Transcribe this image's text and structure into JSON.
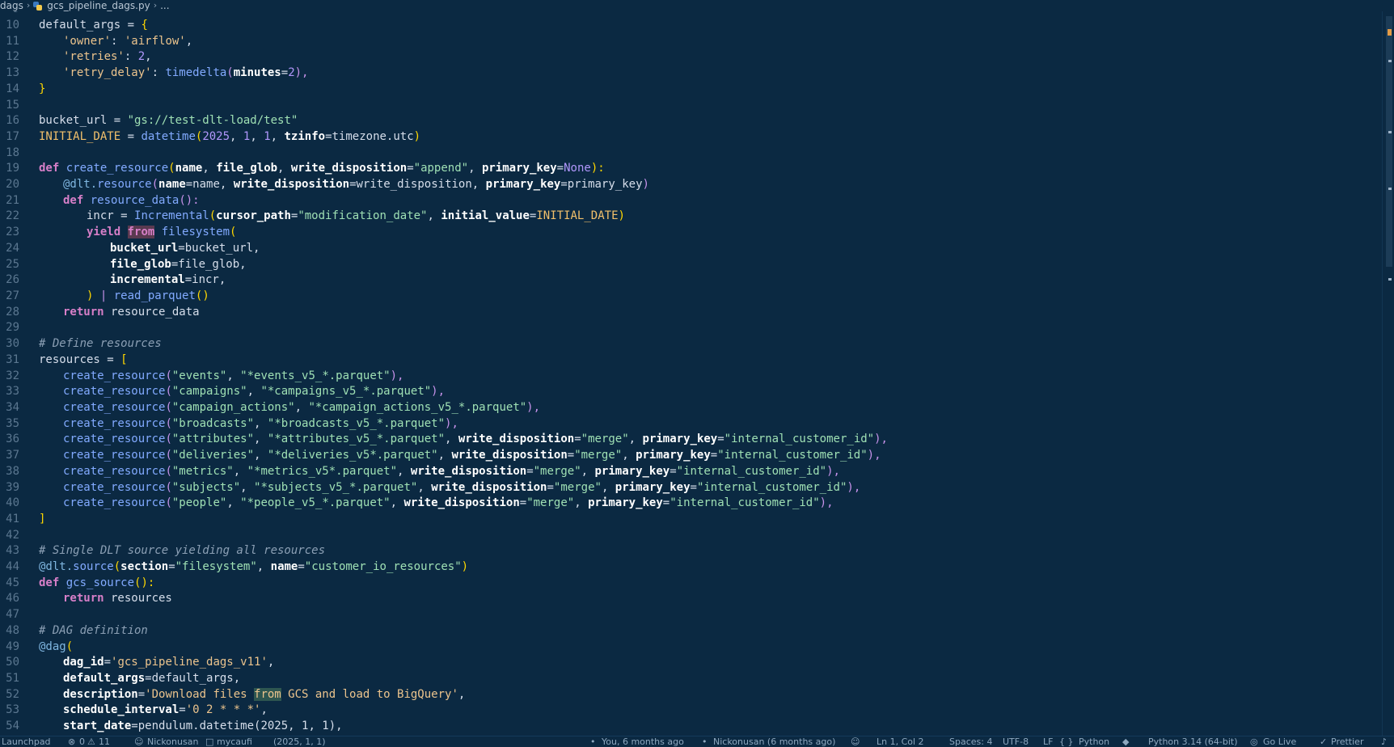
{
  "breadcrumb": {
    "folder": "dags",
    "file": "gcs_pipeline_dags.py",
    "more": "..."
  },
  "editor": {
    "first_visible_line": "9"
  },
  "code": {
    "l10": {
      "ln": "10",
      "t1": "default_args = ",
      "t2": "{"
    },
    "l11": {
      "ln": "11",
      "t1": "'owner'",
      "t2": ": ",
      "t3": "'airflow'",
      "t4": ","
    },
    "l12": {
      "ln": "12",
      "t1": "'retries'",
      "t2": ": ",
      "t3": "2",
      "t4": ","
    },
    "l13": {
      "ln": "13",
      "t1": "'retry_delay'",
      "t2": ": ",
      "t3": "timedelta",
      "t4": "(",
      "t5": "minutes",
      "t6": "=",
      "t7": "2",
      "t8": "),"
    },
    "l14": {
      "ln": "14",
      "t1": "}"
    },
    "l15": {
      "ln": "15"
    },
    "l16": {
      "ln": "16",
      "t1": "bucket_url = ",
      "t2": "\"gs://test-dlt-load/test\""
    },
    "l17": {
      "ln": "17",
      "t1": "INITIAL_DATE",
      "t2": " = ",
      "t3": "datetime",
      "t4": "(",
      "t5": "2025",
      "t6": ", ",
      "t7": "1",
      "t8": ", ",
      "t9": "1",
      "t10": ", ",
      "t11": "tzinfo",
      "t12": "=timezone.utc",
      "t13": ")"
    },
    "l18": {
      "ln": "18"
    },
    "l19": {
      "ln": "19",
      "t1": "def",
      "t2": " ",
      "t3": "create_resource",
      "t4": "(",
      "t5": "name",
      "t6": ", ",
      "t7": "file_glob",
      "t8": ", ",
      "t9": "write_disposition",
      "t10": "=",
      "t11": "\"append\"",
      "t12": ", ",
      "t13": "primary_key",
      "t14": "=",
      "t15": "None",
      "t16": "):"
    },
    "l20": {
      "ln": "20",
      "t1": "@dlt.",
      "t2": "resource",
      "t3": "(",
      "t4": "name",
      "t5": "=name, ",
      "t6": "write_disposition",
      "t7": "=write_disposition, ",
      "t8": "primary_key",
      "t9": "=primary_key",
      "t10": ")"
    },
    "l21": {
      "ln": "21",
      "t1": "def",
      "t2": " ",
      "t3": "resource_data",
      "t4": "():"
    },
    "l22": {
      "ln": "22",
      "t1": "incr = ",
      "t2": "Incremental",
      "t3": "(",
      "t4": "cursor_path",
      "t5": "=",
      "t6": "\"modification_date\"",
      "t7": ", ",
      "t8": "initial_value",
      "t9": "=",
      "t10": "INITIAL_DATE",
      "t11": ")"
    },
    "l23": {
      "ln": "23",
      "t1": "yield",
      "t2": " ",
      "t3": "from",
      "t4": " ",
      "t5": "filesystem",
      "t6": "("
    },
    "l24": {
      "ln": "24",
      "t1": "bucket_url",
      "t2": "=bucket_url,"
    },
    "l25": {
      "ln": "25",
      "t1": "file_glob",
      "t2": "=file_glob,"
    },
    "l26": {
      "ln": "26",
      "t1": "incremental",
      "t2": "=incr,"
    },
    "l27": {
      "ln": "27",
      "t1": ")",
      "t2": " | ",
      "t3": "read_parquet",
      "t4": "()"
    },
    "l28": {
      "ln": "28",
      "t1": "return",
      "t2": " resource_data"
    },
    "l29": {
      "ln": "29"
    },
    "l30": {
      "ln": "30",
      "t1": "# Define resources"
    },
    "l31": {
      "ln": "31",
      "t1": "resources = ",
      "t2": "["
    },
    "l32": {
      "ln": "32",
      "t1": "create_resource",
      "t2": "(",
      "t3": "\"events\"",
      "t4": ", ",
      "t5": "\"*events_v5_*.parquet\"",
      "t6": "),"
    },
    "l33": {
      "ln": "33",
      "t1": "create_resource",
      "t2": "(",
      "t3": "\"campaigns\"",
      "t4": ", ",
      "t5": "\"*campaigns_v5_*.parquet\"",
      "t6": "),"
    },
    "l34": {
      "ln": "34",
      "t1": "create_resource",
      "t2": "(",
      "t3": "\"campaign_actions\"",
      "t4": ", ",
      "t5": "\"*campaign_actions_v5_*.parquet\"",
      "t6": "),"
    },
    "l35": {
      "ln": "35",
      "t1": "create_resource",
      "t2": "(",
      "t3": "\"broadcasts\"",
      "t4": ", ",
      "t5": "\"*broadcasts_v5_*.parquet\"",
      "t6": "),"
    },
    "l36": {
      "ln": "36",
      "t1": "create_resource",
      "t2": "(",
      "t3": "\"attributes\"",
      "t4": ", ",
      "t5": "\"*attributes_v5_*.parquet\"",
      "t6": ", ",
      "t7": "write_disposition",
      "t8": "=",
      "t9": "\"merge\"",
      "t10": ", ",
      "t11": "primary_key",
      "t12": "=",
      "t13": "\"internal_customer_id\"",
      "t14": "),"
    },
    "l37": {
      "ln": "37",
      "t1": "create_resource",
      "t2": "(",
      "t3": "\"deliveries\"",
      "t4": ", ",
      "t5": "\"*deliveries_v5*.parquet\"",
      "t6": ", ",
      "t7": "write_disposition",
      "t8": "=",
      "t9": "\"merge\"",
      "t10": ", ",
      "t11": "primary_key",
      "t12": "=",
      "t13": "\"internal_customer_id\"",
      "t14": "),"
    },
    "l38": {
      "ln": "38",
      "t1": "create_resource",
      "t2": "(",
      "t3": "\"metrics\"",
      "t4": ", ",
      "t5": "\"*metrics_v5*.parquet\"",
      "t6": ", ",
      "t7": "write_disposition",
      "t8": "=",
      "t9": "\"merge\"",
      "t10": ", ",
      "t11": "primary_key",
      "t12": "=",
      "t13": "\"internal_customer_id\"",
      "t14": "),"
    },
    "l39": {
      "ln": "39",
      "t1": "create_resource",
      "t2": "(",
      "t3": "\"subjects\"",
      "t4": ", ",
      "t5": "\"*subjects_v5_*.parquet\"",
      "t6": ", ",
      "t7": "write_disposition",
      "t8": "=",
      "t9": "\"merge\"",
      "t10": ", ",
      "t11": "primary_key",
      "t12": "=",
      "t13": "\"internal_customer_id\"",
      "t14": "),"
    },
    "l40": {
      "ln": "40",
      "t1": "create_resource",
      "t2": "(",
      "t3": "\"people\"",
      "t4": ", ",
      "t5": "\"*people_v5_*.parquet\"",
      "t6": ", ",
      "t7": "write_disposition",
      "t8": "=",
      "t9": "\"merge\"",
      "t10": ", ",
      "t11": "primary_key",
      "t12": "=",
      "t13": "\"internal_customer_id\"",
      "t14": "),"
    },
    "l41": {
      "ln": "41",
      "t1": "]"
    },
    "l42": {
      "ln": "42"
    },
    "l43": {
      "ln": "43",
      "t1": "# Single DLT source yielding all resources"
    },
    "l44": {
      "ln": "44",
      "t1": "@dlt.",
      "t2": "source",
      "t3": "(",
      "t4": "section",
      "t5": "=",
      "t6": "\"filesystem\"",
      "t7": ", ",
      "t8": "name",
      "t9": "=",
      "t10": "\"customer_io_resources\"",
      "t11": ")"
    },
    "l45": {
      "ln": "45",
      "t1": "def",
      "t2": " ",
      "t3": "gcs_source",
      "t4": "():"
    },
    "l46": {
      "ln": "46",
      "t1": "return",
      "t2": " resources"
    },
    "l47": {
      "ln": "47"
    },
    "l48": {
      "ln": "48",
      "t1": "# DAG definition"
    },
    "l49": {
      "ln": "49",
      "t1": "@dag",
      "t2": "("
    },
    "l50": {
      "ln": "50",
      "t1": "dag_id",
      "t2": "=",
      "t3": "'gcs_pipeline_dags_v11'",
      "t4": ","
    },
    "l51": {
      "ln": "51",
      "t1": "default_args",
      "t2": "=default_args,"
    },
    "l52": {
      "ln": "52",
      "t1": "description",
      "t2": "=",
      "t3": "'Download files ",
      "t4": "from",
      "t5": " GCS and load to BigQuery'",
      "t6": ","
    },
    "l53": {
      "ln": "53",
      "t1": "schedule_interval",
      "t2": "=",
      "t3": "'0 2 * * *'",
      "t4": ","
    },
    "l54": {
      "ln": "54",
      "t1": "start_date",
      "t2": "=pendulum.datetime(2025, 1, 1),"
    }
  },
  "statusbar": {
    "launchpad": "Launchpad",
    "errors": "0",
    "warnings": "11",
    "user": "Nickonusan",
    "branch": "mycaufi",
    "timeline": "(2025, 1, 1)",
    "blame": "You, 6 months ago",
    "author": "Nickonusan (6 months ago)",
    "position": "Ln 1, Col 2",
    "spaces": "Spaces: 4",
    "encoding": "UTF-8",
    "eol": "LF",
    "language": "Python",
    "interpreter": "Python 3.14 (64-bit)",
    "golive": "Go Live",
    "prettier": "Prettier"
  },
  "colors": {
    "background": "#0b2942",
    "keyword": "#d77fc8",
    "function": "#82aaff",
    "string": "#9fe0b4",
    "number": "#b197fc"
  }
}
